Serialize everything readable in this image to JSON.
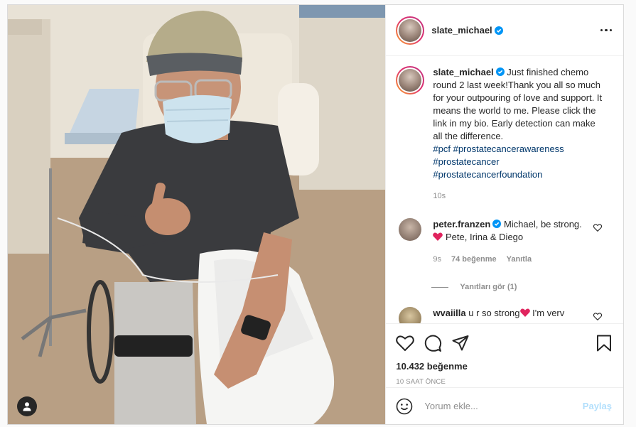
{
  "post": {
    "author": "slate_michael",
    "more_icon": "more-horizontal-icon",
    "caption": {
      "text": "Just finished chemo round 2 last week!Thank you all so much for your outpouring of love and support. It means the world to me. Please click the link in my bio. Early detection can make all the difference.",
      "hashtags": [
        "#pcf",
        "#prostatecancerawareness",
        "#prostatecancer",
        "#prostatecancerfoundation"
      ],
      "time": "10s"
    },
    "comments": [
      {
        "username": "peter.franzen",
        "text_before_heart": "Michael, be strong.",
        "text_after_heart": "Pete, Irina & Diego",
        "time": "9s",
        "likes": "74 beğenme",
        "reply_label": "Yanıtla",
        "view_replies": "Yanıtları gör (1)"
      },
      {
        "username": "wvaiilla",
        "text_before_heart": "u r so strong",
        "text_after_heart": "I'm verv"
      }
    ],
    "likes_count": "10.432 beğenme",
    "time_ago": "10 SAAT ÖNCE",
    "add_comment": {
      "placeholder": "Yorum ekle...",
      "post_label": "Paylaş"
    },
    "colors": {
      "accent_blue": "#0095f6",
      "disabled_blue": "#b2dffc",
      "hashtag": "#00376b",
      "heart_red": "#ed4956",
      "muted": "#8e8e8e"
    }
  }
}
